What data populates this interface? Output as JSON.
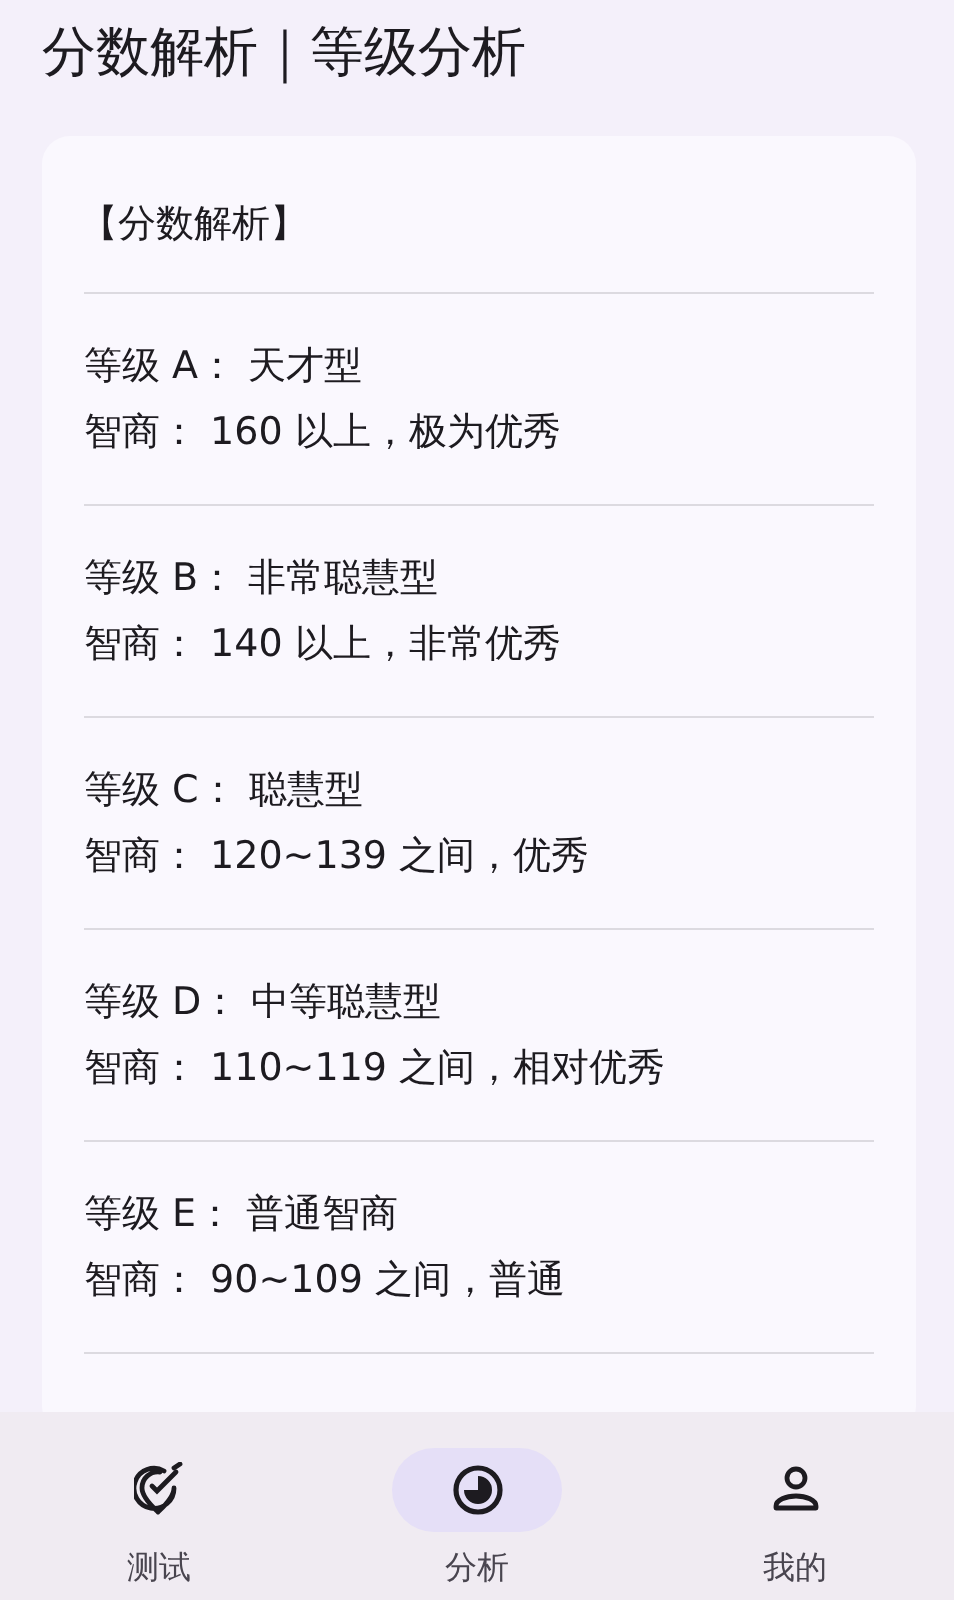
{
  "header": {
    "title": "分数解析｜等级分析"
  },
  "card": {
    "heading": "【分数解析】",
    "grades": [
      {
        "grade": "等级 A： 天才型",
        "iq": "智商： 160 以上，极为优秀"
      },
      {
        "grade": "等级 B： 非常聪慧型",
        "iq": "智商： 140 以上，非常优秀"
      },
      {
        "grade": "等级 C： 聪慧型",
        "iq": "智商： 120~139 之间，优秀"
      },
      {
        "grade": "等级 D： 中等聪慧型",
        "iq": "智商： 110~119 之间，相对优秀"
      },
      {
        "grade": "等级 E： 普通智商",
        "iq": "智商： 90~109 之间，普通"
      }
    ]
  },
  "bottom_nav": [
    {
      "label": "测试",
      "kind": "test",
      "selected": false
    },
    {
      "label": "分析",
      "kind": "analysis",
      "selected": true
    },
    {
      "label": "我的",
      "kind": "profile",
      "selected": false
    }
  ]
}
